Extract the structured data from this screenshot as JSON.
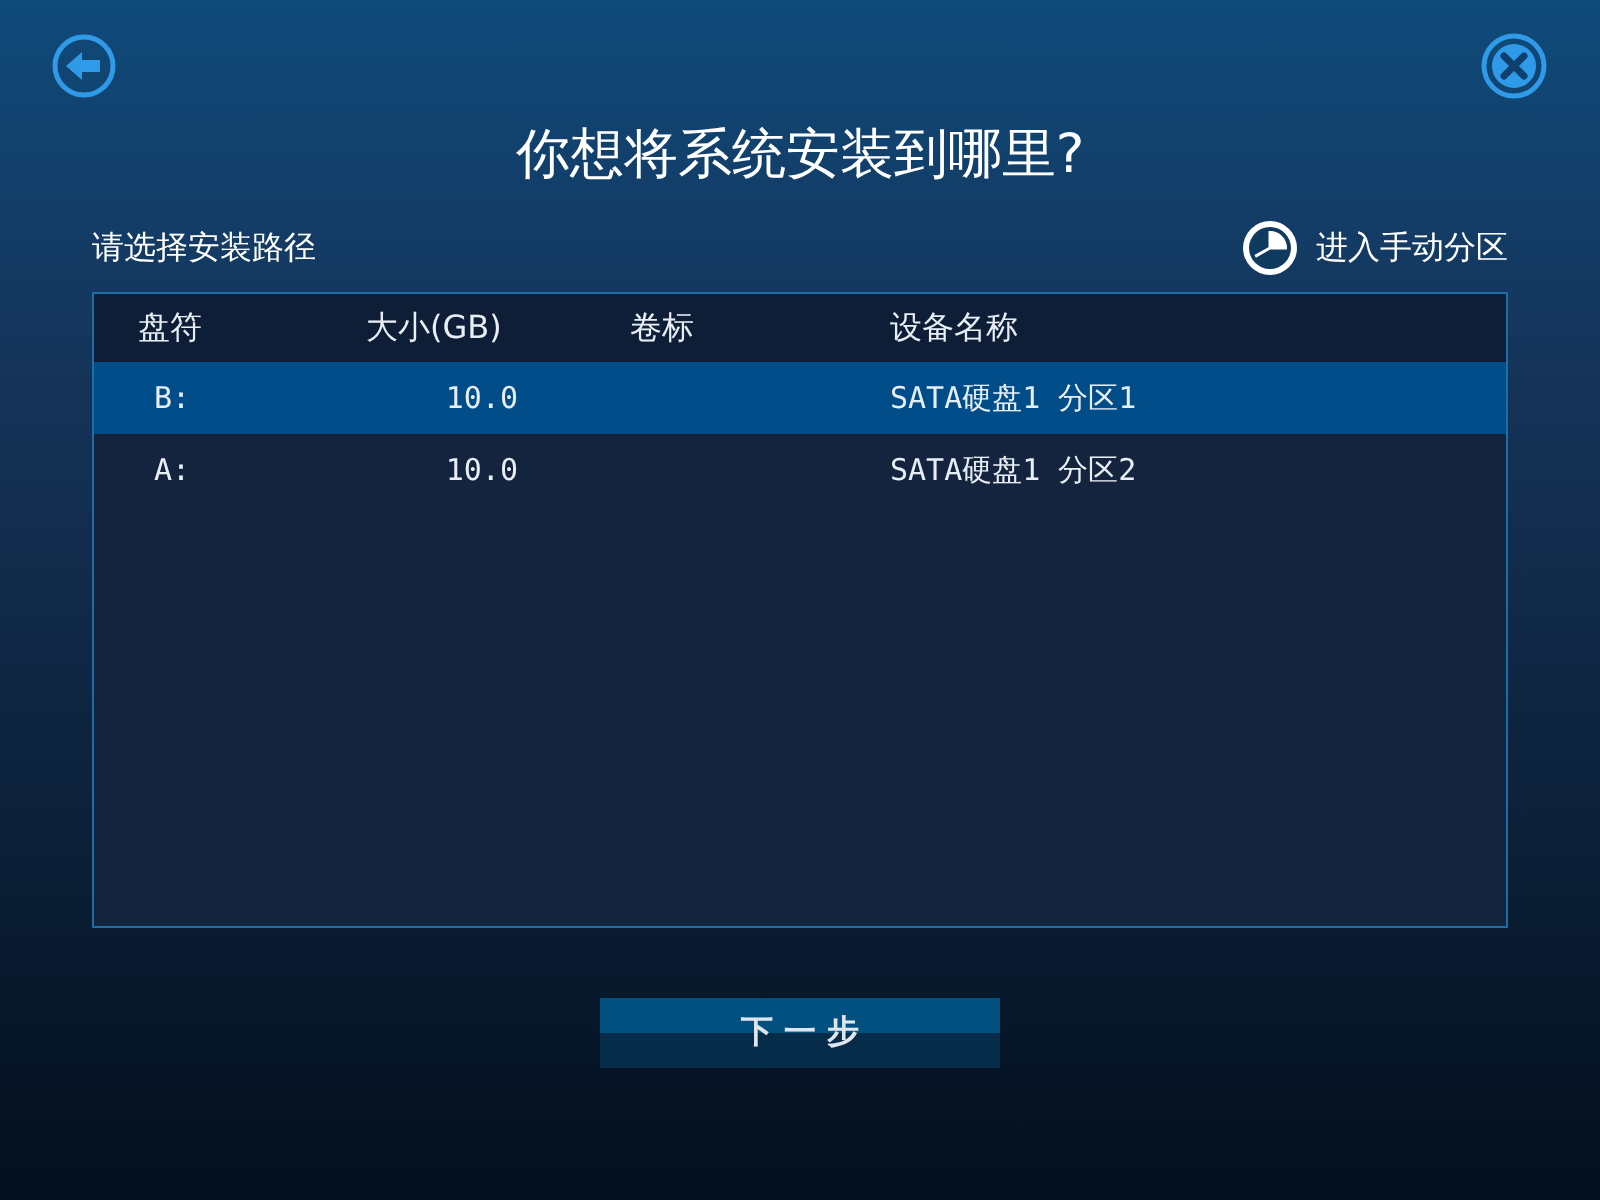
{
  "title": "你想将系统安装到哪里?",
  "subtitle": "请选择安装路径",
  "manual_link": "进入手动分区",
  "table": {
    "columns": [
      "盘符",
      "大小(GB)",
      "卷标",
      "设备名称"
    ],
    "rows": [
      {
        "drive": "B:",
        "size": "10.0",
        "device": "SATA硬盘1 分区1",
        "selected": true
      },
      {
        "drive": "A:",
        "size": "10.0",
        "device": "SATA硬盘1 分区2",
        "selected": false
      }
    ]
  },
  "next_button": "下 一 步"
}
